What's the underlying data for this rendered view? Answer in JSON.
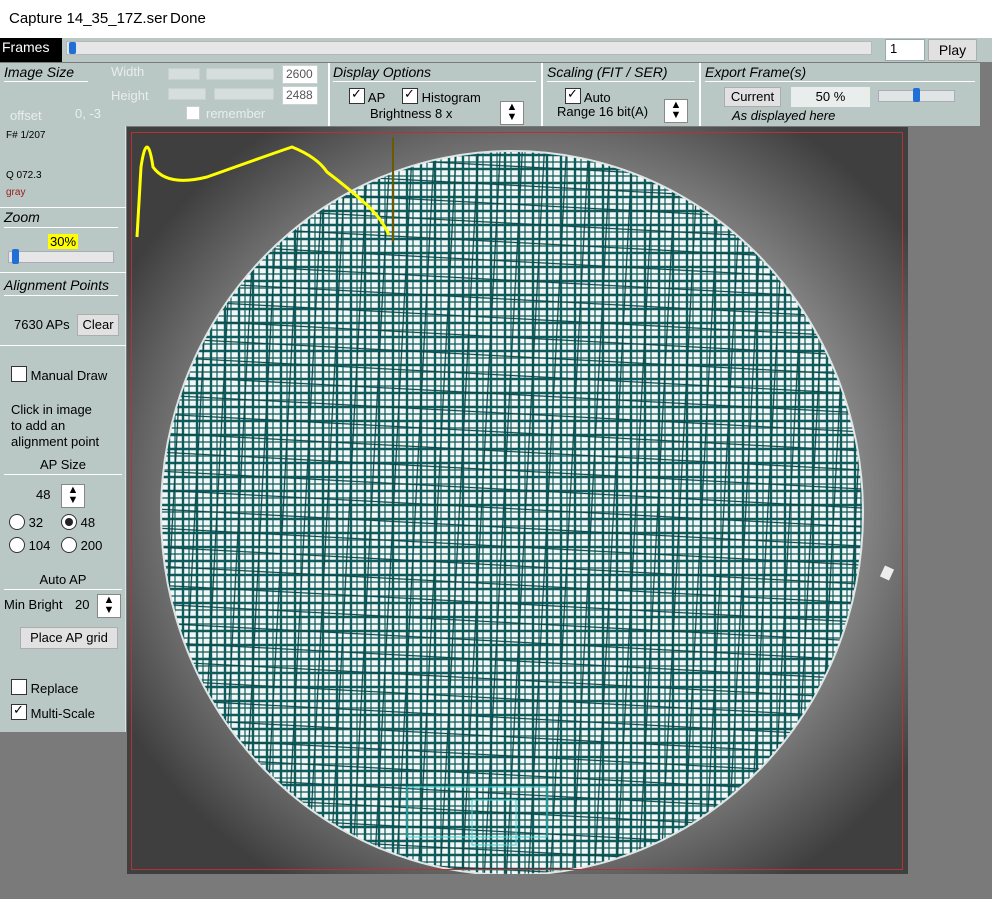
{
  "window": {
    "title": "Capture 14_35_17Z.ser",
    "status": "Done"
  },
  "frames": {
    "label": "Frames",
    "current": "1",
    "play_label": "Play",
    "progress": 0.0
  },
  "image_size": {
    "title": "Image Size",
    "width_label": "Width",
    "height_label": "Height",
    "width_value": "2600",
    "height_value": "2488",
    "offset_label": "offset",
    "offset_value": "0, -3",
    "remember_label": "remember"
  },
  "display_options": {
    "title": "Display Options",
    "ap_label": "AP",
    "ap_checked": true,
    "histogram_label": "Histogram",
    "histogram_checked": true,
    "brightness_label": "Brightness 8 x"
  },
  "scaling": {
    "title": "Scaling (FIT / SER)",
    "auto_label": "Auto",
    "auto_checked": true,
    "range_label": "Range 16 bit(A)"
  },
  "export": {
    "title": "Export Frame(s)",
    "current_label": "Current",
    "percent": "50 %",
    "note": "As displayed here",
    "slider_level": 0.5
  },
  "info": {
    "frame": "F# 1/207",
    "quality": "Q  072.3",
    "color_mode": "gray"
  },
  "zoom": {
    "title": "Zoom",
    "value": "30%",
    "slider_level": 0.05
  },
  "alignment_points": {
    "title": "Alignment Points",
    "count": "7630 APs",
    "clear_label": "Clear",
    "manual_draw_label": "Manual Draw",
    "instructions": [
      "Click in image",
      "to add an",
      "alignment point"
    ],
    "ap_size_title": "AP Size",
    "ap_size_value": "48",
    "sizes": [
      {
        "label": "32",
        "selected": false
      },
      {
        "label": "48",
        "selected": true
      },
      {
        "label": "104",
        "selected": false
      },
      {
        "label": "200",
        "selected": false
      }
    ],
    "auto_ap_title": "Auto AP",
    "min_bright_label": "Min Bright",
    "min_bright_value": "20",
    "place_grid_label": "Place AP grid",
    "replace_label": "Replace",
    "replace_checked": false,
    "multiscale_label": "Multi-Scale",
    "multiscale_checked": true
  },
  "colors": {
    "ap_box": "#0e5b5b",
    "ap_box_edge": "#3ed0d0",
    "histogram": "#ffff00",
    "border": "#b73333",
    "panel": "#b9c7c5"
  }
}
